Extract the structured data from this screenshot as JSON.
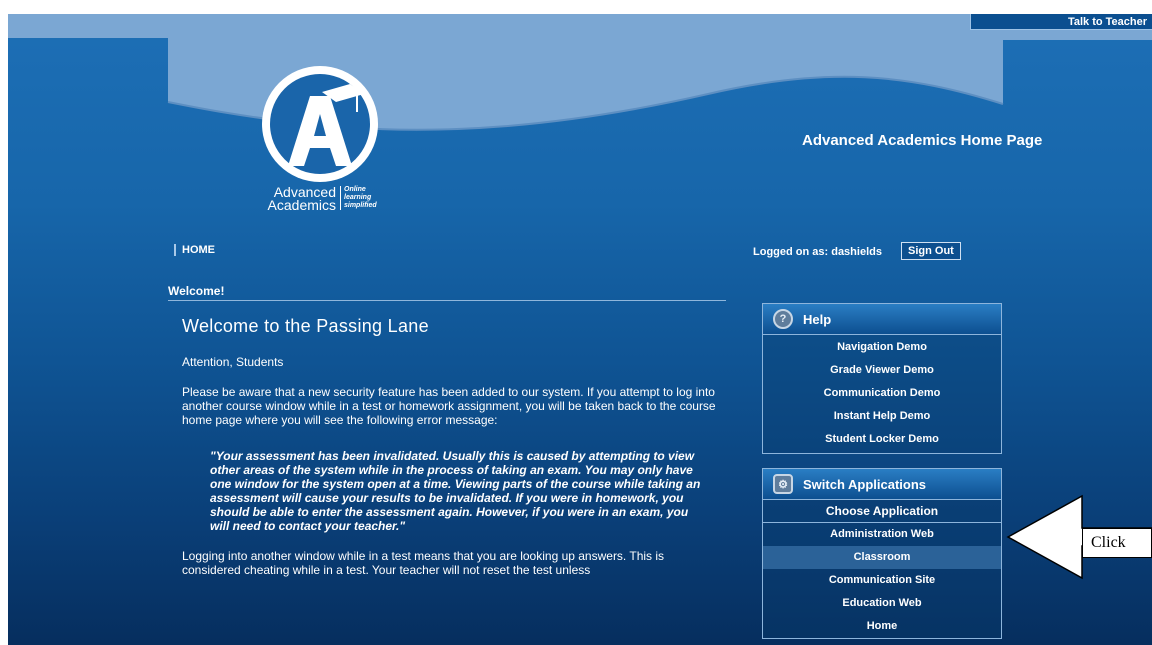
{
  "header": {
    "talk_button": "Talk to Teacher",
    "page_title": "Advanced Academics Home Page",
    "logo": {
      "name_line1": "Advanced",
      "name_line2": "Academics",
      "tagline1": "Online",
      "tagline2": "learning",
      "tagline3": "simplified"
    }
  },
  "nav": {
    "home_label": "HOME",
    "logged_on": "Logged on as: dashields",
    "sign_out": "Sign Out"
  },
  "main": {
    "section_label": "Welcome!",
    "heading": "Welcome to the Passing Lane",
    "attention": "Attention, Students",
    "para1": "Please be aware that a new security feature has been added to our system. If you attempt to log into another course window while in a test or homework assignment, you will be taken back to the course home page where you will see the following error message:",
    "quote": "\"Your assessment has been invalidated. Usually this is caused by attempting to view other areas of the system while in the process of taking an exam. You may only have one window for the system open at a time. Viewing parts of the course while taking an assessment will cause your results to be invalidated. If you were in homework, you should be able to enter the assessment again. However, if you were in an exam, you will need to contact your teacher.\"",
    "para2": "Logging into another window while in a test means that you are looking up answers. This is considered cheating while in a test. Your teacher will not reset the test unless"
  },
  "help_panel": {
    "title": "Help",
    "items": [
      "Navigation Demo",
      "Grade Viewer Demo",
      "Communication Demo",
      "Instant Help Demo",
      "Student Locker Demo"
    ]
  },
  "switch_panel": {
    "title": "Switch Applications",
    "subheader": "Choose Application",
    "items": [
      "Administration Web",
      "Classroom",
      "Communication Site",
      "Education Web",
      "Home"
    ],
    "selected": "Classroom"
  },
  "callout": {
    "text": "Click"
  },
  "colors": {
    "page_blue": "#1766aa",
    "wave_light": "#7aa6d3",
    "dark_navy": "#062e5e"
  }
}
